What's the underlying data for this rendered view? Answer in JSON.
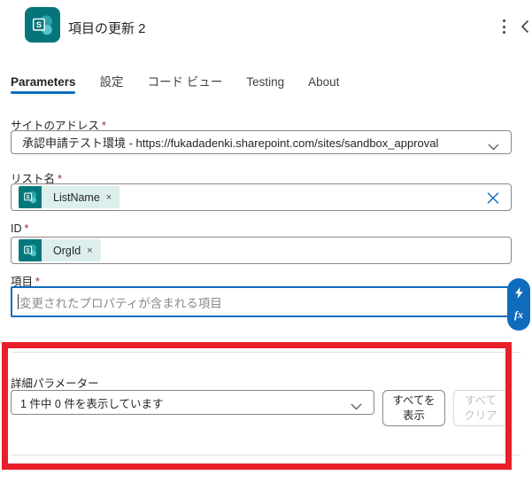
{
  "header": {
    "title": "項目の更新 2",
    "connector": "SharePoint"
  },
  "tabs": [
    {
      "label": "Parameters",
      "selected": true
    },
    {
      "label": "設定",
      "selected": false
    },
    {
      "label": "コード ビュー",
      "selected": false
    },
    {
      "label": "Testing",
      "selected": false
    },
    {
      "label": "About",
      "selected": false
    }
  ],
  "fields": {
    "site_address": {
      "label": "サイトのアドレス",
      "value": "承認申請テスト環境 - https://fukadadenki.sharepoint.com/sites/sandbox_approval"
    },
    "list_name": {
      "label": "リスト名",
      "token": "ListName"
    },
    "id": {
      "label": "ID",
      "token": "OrgId"
    },
    "item": {
      "label": "項目",
      "placeholder": "変更されたプロパティが含まれる項目"
    }
  },
  "advanced": {
    "label": "詳細パラメーター",
    "dropdown_value": "1 件中 0 件を表示しています",
    "show_all_button": "すべてを表示",
    "clear_all_button": "すべてクリア"
  },
  "ui": {
    "required_mark": "*",
    "remove_glyph": "×",
    "expression_label": "fx",
    "sharepoint_letter": "S"
  },
  "icons": {
    "header_icon": "sharepoint-logo",
    "more_options": "vertical-ellipsis",
    "collapse": "chevron-left",
    "dropdown": "chevron-down",
    "clear_field": "blue-x",
    "dynamic_content": "lightning-bolt",
    "expression": "fx"
  },
  "colors": {
    "accent_blue": "#0f6cbd",
    "sharepoint_teal": "#03787c",
    "token_background": "#ddefed",
    "annotation_red": "#e8202b",
    "required_red": "#a4262c",
    "field_border": "#8a8886"
  }
}
